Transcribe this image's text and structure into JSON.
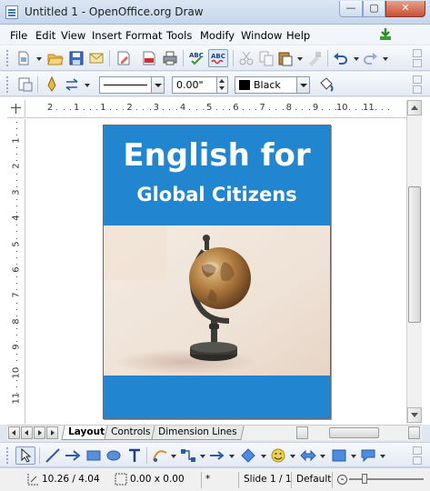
{
  "window": {
    "title": "Untitled 1 - OpenOffice.org Draw",
    "minimize": "—",
    "maximize": "▢",
    "close": "✕"
  },
  "menu": [
    "File",
    "Edit",
    "View",
    "Insert",
    "Format",
    "Tools",
    "Modify",
    "Window",
    "Help"
  ],
  "line_toolbar": {
    "line_style": "",
    "line_width": "0.00\"",
    "line_color": "Black",
    "line_color_swatch": "#000000"
  },
  "rulers": {
    "horizontal_ticks": [
      "2",
      "1",
      "1",
      "2",
      "3",
      "4",
      "5",
      "6",
      "7",
      "8",
      "9",
      "10",
      "11"
    ],
    "vertical_ticks": [
      "1",
      "2",
      "3",
      "4",
      "5",
      "6",
      "7",
      "8",
      "9",
      "10",
      "11"
    ]
  },
  "document": {
    "title": "English for",
    "subtitle": "Global Citizens",
    "page_color": "#2185d0"
  },
  "tabs": [
    "Layout",
    "Controls",
    "Dimension Lines"
  ],
  "statusbar": {
    "position": "10.26 / 4.04",
    "size": "0.00 x 0.00",
    "modified": "*",
    "slide": "Slide 1 / 1",
    "layout": "Default"
  },
  "icons": {
    "standard": [
      "new-icon",
      "open-icon",
      "save-icon",
      "send-icon",
      "edit-file-icon",
      "export-pdf-icon",
      "print-icon",
      "spellcheck-icon",
      "autospellcheck-icon",
      "cut-icon",
      "copy-icon",
      "paste-icon",
      "clone-formatting-icon",
      "undo-icon",
      "redo-icon"
    ],
    "drawing": [
      "select-icon",
      "line-icon",
      "arrow-line-icon",
      "rectangle-icon",
      "ellipse-icon",
      "text-icon",
      "curve-icon",
      "connector-icon",
      "lines-arrows-icon",
      "basic-shapes-icon",
      "symbol-shapes-icon",
      "block-arrows-icon",
      "flowchart-icon",
      "callouts-icon"
    ]
  }
}
